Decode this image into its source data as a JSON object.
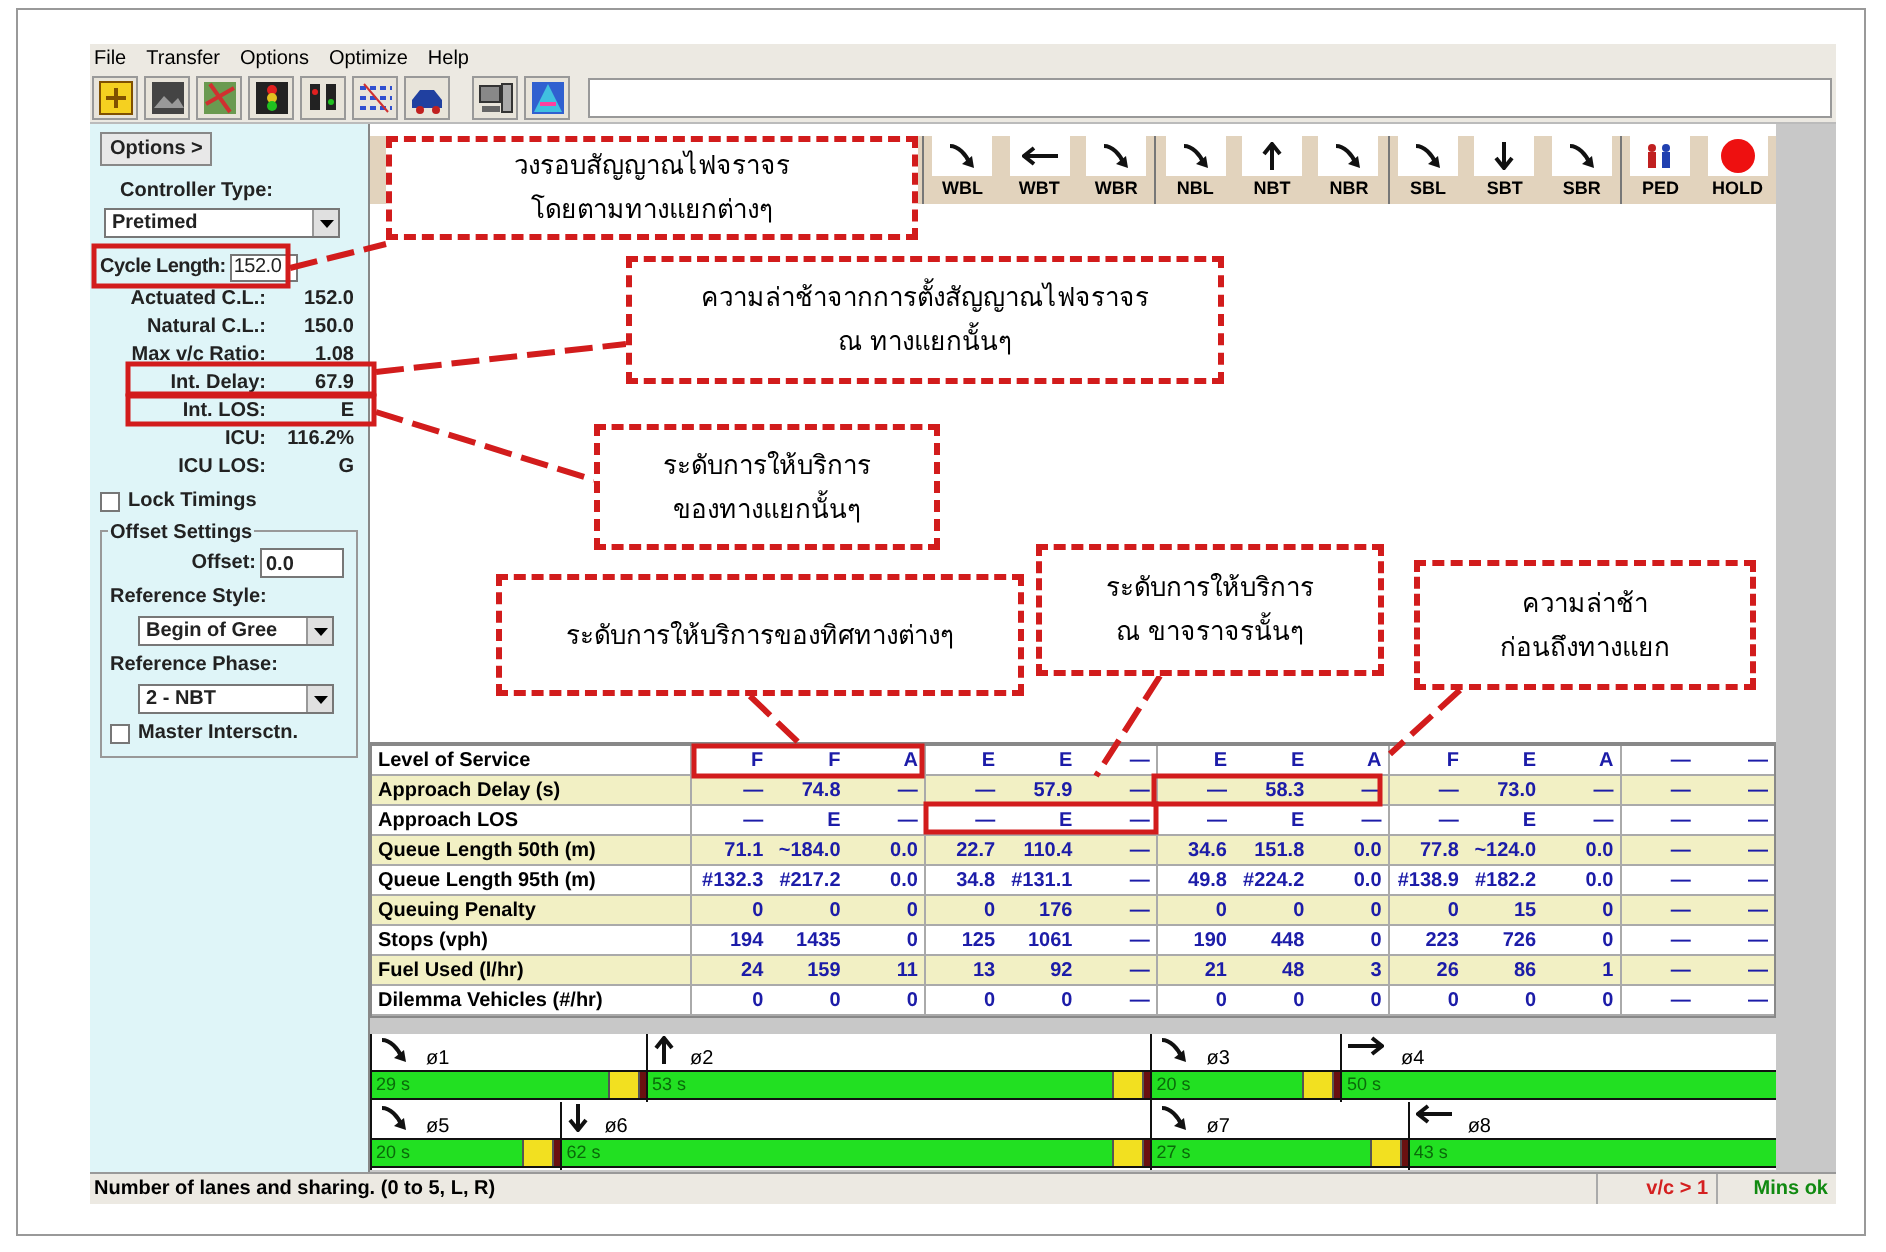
{
  "menu": [
    "File",
    "Transfer",
    "Options",
    "Optimize",
    "Help"
  ],
  "toolbar": [
    {
      "kind": "plus"
    },
    {
      "kind": "image"
    },
    {
      "kind": "map"
    },
    {
      "kind": "light"
    },
    {
      "kind": "lights"
    },
    {
      "kind": "lanes"
    },
    {
      "kind": "car"
    },
    {
      "kind": "computer"
    },
    {
      "kind": "gradient"
    }
  ],
  "left_panel": {
    "options_button": "Options >",
    "controller_type": {
      "label": "Controller Type:",
      "value": "Pretimed"
    },
    "cycle_length": {
      "label": "Cycle Length:",
      "value": "152.0"
    },
    "readouts": [
      {
        "label": "Actuated C.L.:",
        "value": "152.0"
      },
      {
        "label": "Natural C.L.:",
        "value": "150.0"
      },
      {
        "label": "Max v/c Ratio:",
        "value": "1.08"
      },
      {
        "label": "Int. Delay:",
        "value": "67.9"
      },
      {
        "label": "Int. LOS:",
        "value": "E"
      },
      {
        "label": "ICU:",
        "value": "116.2%"
      },
      {
        "label": "ICU LOS:",
        "value": "G"
      }
    ],
    "lock_timings": {
      "label": "Lock Timings",
      "checked": false
    },
    "offset_settings": {
      "title": "Offset Settings",
      "offset": {
        "label": "Offset:",
        "value": "0.0"
      },
      "reference_style": {
        "label": "Reference Style:",
        "value": "Begin of Gree"
      },
      "reference_phase": {
        "label": "Reference Phase:",
        "value": "2 - NBT"
      },
      "master": {
        "label": "Master Intersctn.",
        "checked": false
      }
    }
  },
  "movements": [
    {
      "label": "WBL",
      "kind": "turn"
    },
    {
      "label": "WBT",
      "kind": "left"
    },
    {
      "label": "WBR",
      "kind": "turn"
    },
    {
      "label": "NBL",
      "kind": "turn"
    },
    {
      "label": "NBT",
      "kind": "up"
    },
    {
      "label": "NBR",
      "kind": "turn"
    },
    {
      "label": "SBL",
      "kind": "turn"
    },
    {
      "label": "SBT",
      "kind": "down"
    },
    {
      "label": "SBR",
      "kind": "turn"
    },
    {
      "label": "PED",
      "kind": "ped"
    },
    {
      "label": "HOLD",
      "kind": "hold"
    }
  ],
  "table": {
    "rows": [
      {
        "label": "Level of Service",
        "cells": [
          "F",
          "F",
          "A",
          "E",
          "E",
          "—",
          "E",
          "E",
          "A",
          "F",
          "E",
          "A",
          "—",
          "—"
        ]
      },
      {
        "label": "Approach Delay (s)",
        "cells": [
          "—",
          "74.8",
          "—",
          "—",
          "57.9",
          "—",
          "—",
          "58.3",
          "—",
          "—",
          "73.0",
          "—",
          "—",
          "—"
        ]
      },
      {
        "label": "Approach LOS",
        "cells": [
          "—",
          "E",
          "—",
          "—",
          "E",
          "—",
          "—",
          "E",
          "—",
          "—",
          "E",
          "—",
          "—",
          "—"
        ]
      },
      {
        "label": "Queue Length 50th (m)",
        "cells": [
          "71.1",
          "~184.0",
          "0.0",
          "22.7",
          "110.4",
          "—",
          "34.6",
          "151.8",
          "0.0",
          "77.8",
          "~124.0",
          "0.0",
          "—",
          "—"
        ]
      },
      {
        "label": "Queue Length 95th (m)",
        "cells": [
          "#132.3",
          "#217.2",
          "0.0",
          "34.8",
          "#131.1",
          "—",
          "49.8",
          "#224.2",
          "0.0",
          "#138.9",
          "#182.2",
          "0.0",
          "—",
          "—"
        ]
      },
      {
        "label": "Queuing Penalty",
        "cells": [
          "0",
          "0",
          "0",
          "0",
          "176",
          "—",
          "0",
          "0",
          "0",
          "0",
          "15",
          "0",
          "—",
          "—"
        ]
      },
      {
        "label": "Stops (vph)",
        "cells": [
          "194",
          "1435",
          "0",
          "125",
          "1061",
          "—",
          "190",
          "448",
          "0",
          "223",
          "726",
          "0",
          "—",
          "—"
        ]
      },
      {
        "label": "Fuel Used (l/hr)",
        "cells": [
          "24",
          "159",
          "11",
          "13",
          "92",
          "—",
          "21",
          "48",
          "3",
          "26",
          "86",
          "1",
          "—",
          "—"
        ]
      },
      {
        "label": "Dilemma Vehicles (#/hr)",
        "cells": [
          "0",
          "0",
          "0",
          "0",
          "0",
          "—",
          "0",
          "0",
          "0",
          "0",
          "0",
          "0",
          "—",
          "—"
        ]
      }
    ]
  },
  "rings": [
    [
      {
        "label": "ø1",
        "duration": "29 s",
        "kind": "turn"
      },
      {
        "label": "ø2",
        "duration": "53 s",
        "kind": "up"
      },
      {
        "label": "ø3",
        "duration": "20 s",
        "kind": "turn"
      },
      {
        "label": "ø4",
        "duration": "50 s",
        "kind": "right"
      }
    ],
    [
      {
        "label": "ø5",
        "duration": "20 s",
        "kind": "turn"
      },
      {
        "label": "ø6",
        "duration": "62 s",
        "kind": "down"
      },
      {
        "label": "ø7",
        "duration": "27 s",
        "kind": "turn"
      },
      {
        "label": "ø8",
        "duration": "43 s",
        "kind": "left"
      }
    ]
  ],
  "status_bar": {
    "message": "Number of lanes and sharing. (0 to 5, L, R)",
    "indicators": [
      {
        "text": "v/c > 1",
        "color": "#d42020"
      },
      {
        "text": "Mins ok",
        "color": "#118a11"
      }
    ]
  },
  "callouts": [
    "วงรอบสัญญาณไฟจราจร\nโดยตามทางแยกต่างๆ",
    "ความล่าช้าจากการตั้งสัญญาณไฟจราจร\nณ ทางแยกนั้นๆ",
    "ระดับการให้บริการ\nของทางแยกนั้นๆ",
    "ระดับการให้บริการของทิศทางต่างๆ",
    "ระดับการให้บริการ\nณ ขาจราจรนั้นๆ",
    "ความล่าช้า\nก่อนถึงทางแยก"
  ]
}
